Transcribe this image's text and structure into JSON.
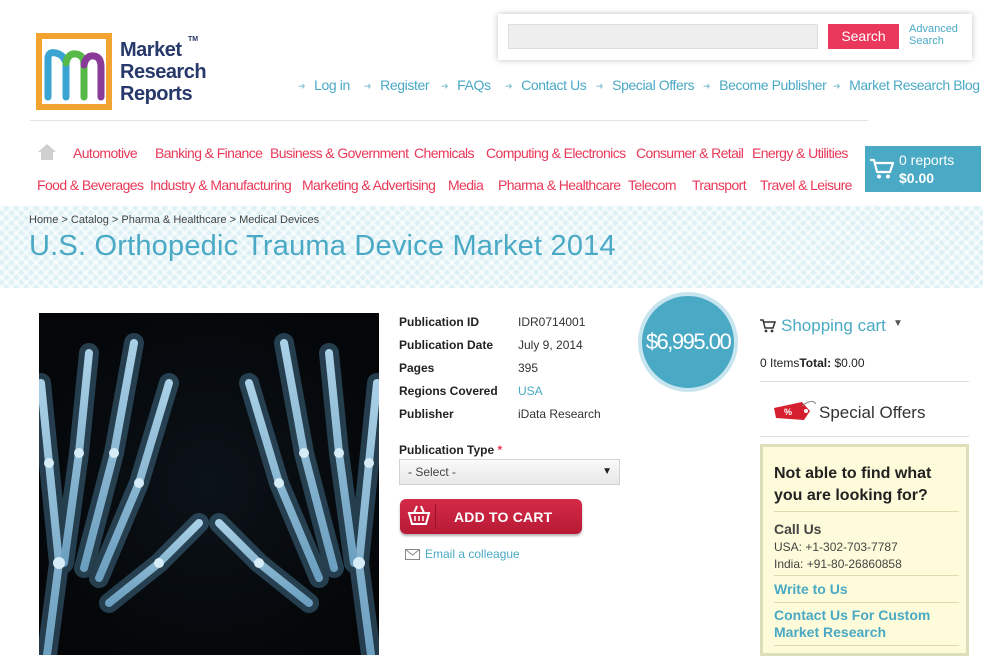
{
  "logo": {
    "lines": [
      "Market",
      "Research",
      "Reports"
    ],
    "tm": "TM"
  },
  "search": {
    "placeholder": "",
    "button": "Search",
    "advanced": "Advanced Search"
  },
  "topnav": [
    "Log in",
    "Register",
    "FAQs",
    "Contact Us",
    "Special Offers",
    "Become Publisher",
    "Market Research Blog"
  ],
  "catnav": {
    "row1": [
      "Automotive",
      "Banking & Finance",
      "Business & Government",
      "Chemicals",
      "Computing & Electronics",
      "Consumer & Retail",
      "Energy & Utilities"
    ],
    "row2": [
      "Food & Beverages",
      "Industry & Manufacturing",
      "Marketing & Advertising",
      "Media",
      "Pharma & Healthcare",
      "Telecom",
      "Transport",
      "Travel & Leisure"
    ]
  },
  "minicart": {
    "reports": "0 reports",
    "total": "$0.00"
  },
  "breadcrumb": [
    "Home",
    "Catalog",
    "Pharma & Healthcare",
    "Medical Devices"
  ],
  "page_title": "U.S. Orthopedic Trauma Device Market 2014",
  "details": [
    {
      "key": "Publication ID",
      "value": "IDR0714001"
    },
    {
      "key": "Publication Date",
      "value": "July 9, 2014"
    },
    {
      "key": "Pages",
      "value": "395"
    },
    {
      "key": "Regions Covered",
      "value": "USA"
    },
    {
      "key": "Publisher",
      "value": "iData Research"
    }
  ],
  "price": "$6,995.00",
  "publication_type": {
    "label": "Publication Type",
    "required": "*",
    "selected": "- Select -"
  },
  "add_to_cart": "ADD TO CART",
  "email_colleague": "Email a colleague",
  "sidebar": {
    "cart_title": "Shopping cart",
    "items": "0 Items",
    "total_label": "Total:",
    "total_value": "$0.00",
    "special_offers": "Special Offers",
    "special_badge": "%",
    "find": {
      "question": "Not able to find what you are looking for?",
      "call_us": "Call Us",
      "usa": "USA: +1-302-703-7787",
      "india": "India: +91-80-26860858",
      "write": "Write to Us",
      "custom": "Contact Us For Custom Market Research"
    }
  },
  "colors": {
    "accent_blue": "#4aa9c5",
    "accent_red": "#e93858",
    "logo_orange": "#f3a32f",
    "logo_navy": "#27386a"
  },
  "icons": [
    "home-icon",
    "cart-icon",
    "arrow-icon",
    "basket-icon",
    "envelope-icon",
    "percent-tag-icon",
    "chevron-down-icon"
  ]
}
